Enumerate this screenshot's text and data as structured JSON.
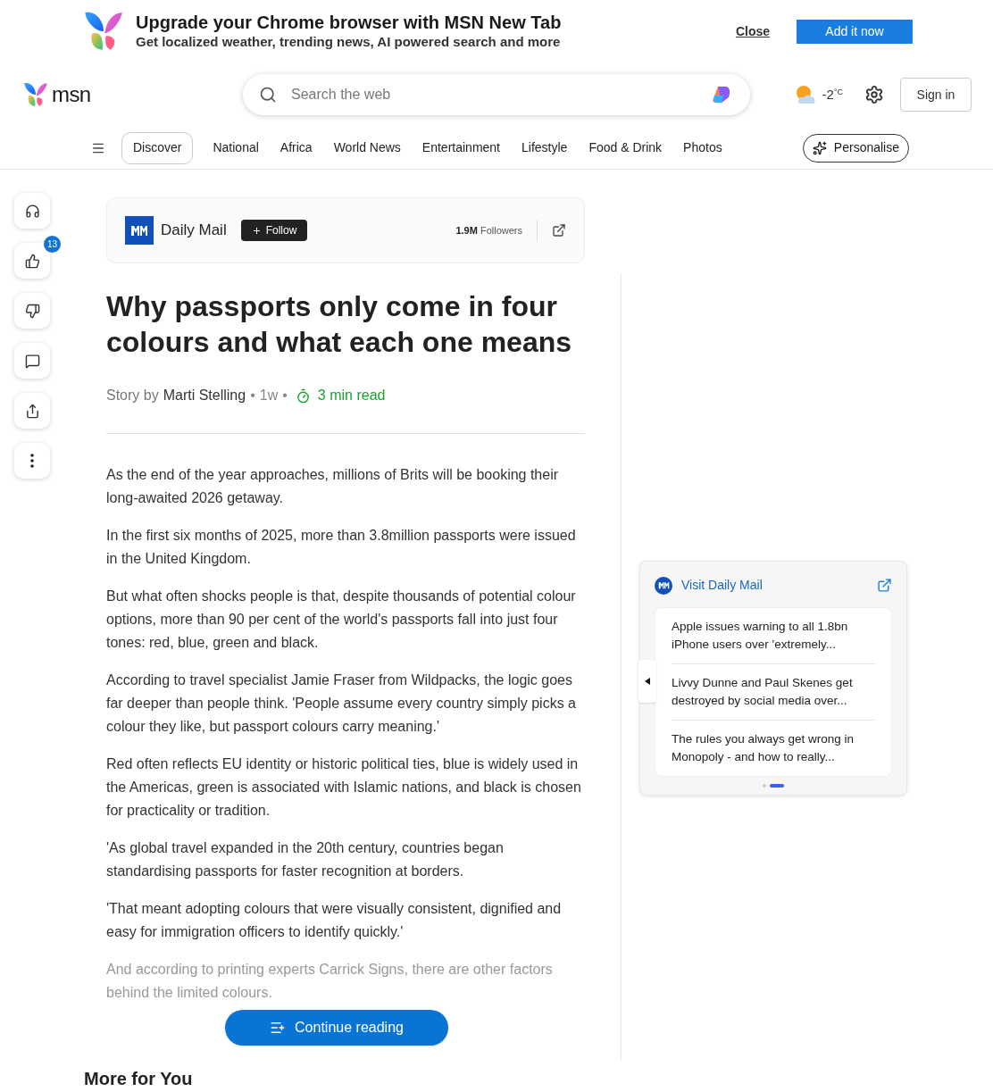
{
  "promo_banner": {
    "title": "Upgrade your Chrome browser with MSN New Tab",
    "subtitle": "Get localized weather, trending news, AI powered search and more",
    "close_link": "Close",
    "action_button": "Add it now"
  },
  "header": {
    "logo_text": "msn",
    "search": {
      "placeholder": "Search the web"
    },
    "weather": {
      "temperature": "-2",
      "unit": "°C"
    },
    "sign_in": "Sign in"
  },
  "nav_tabs": [
    {
      "label": "Discover",
      "selected": true
    },
    {
      "label": "National",
      "selected": false
    },
    {
      "label": "Africa",
      "selected": false
    },
    {
      "label": "World News",
      "selected": false
    },
    {
      "label": "Entertainment",
      "selected": false
    },
    {
      "label": "Lifestyle",
      "selected": false
    },
    {
      "label": "Food & Drink",
      "selected": false
    },
    {
      "label": "Photos",
      "selected": false
    }
  ],
  "personalise_button": "Personalise",
  "action_rail": [
    {
      "kind": "listen"
    },
    {
      "kind": "like",
      "badge": "13"
    },
    {
      "kind": "dislike"
    },
    {
      "kind": "comment"
    },
    {
      "kind": "share"
    },
    {
      "kind": "more"
    }
  ],
  "publisher": {
    "name": "Daily Mail",
    "follow_button": "Follow",
    "followers_count": "1.9M",
    "followers_label": "Followers"
  },
  "article": {
    "title": "Why passports only come in four colours and what each one means",
    "byline_prefix": "Story by",
    "author": "Marti Stelling",
    "separator": "•",
    "age": "1w",
    "read_time": "3 min read",
    "paragraphs": [
      "As the end of the year approaches, millions of Brits will be booking their long-awaited 2026 getaway.",
      "In the first six months of 2025, more than 3.8million passports were issued in the United Kingdom.",
      "But what often shocks people is that, despite thousands of potential colour options, more than 90 per cent of the world's passports fall into just four tones: red, blue, green and black.",
      "According to travel specialist Jamie Fraser from Wildpacks, the logic goes far deeper than people think. 'People assume every country simply picks a colour they like, but passport colours carry meaning.'",
      "Red often reflects EU identity or historic political ties, blue is widely used in the Americas, green is associated with Islamic nations, and black is chosen for practicality or tradition.",
      "'As global travel expanded in the 20th century, countries began standardising passports for faster recognition at borders.",
      "'That meant adopting colours that were visually consistent, dignified and easy for immigration officers to identify quickly.'",
      "And according to printing experts Carrick Signs, there are other factors behind the limited colours."
    ],
    "continue_button": "Continue reading"
  },
  "more_heading": "More for You",
  "side_card": {
    "title": "Visit Daily Mail",
    "stories": [
      "Apple issues warning to all 1.8bn iPhone users over 'extremely...",
      "Livvy Dunne and Paul Skenes get destroyed by social media over...",
      "The rules you always get wrong in Monopoly - and how to really..."
    ],
    "pages": [
      {
        "selected": false
      },
      {
        "selected": true
      }
    ]
  }
}
